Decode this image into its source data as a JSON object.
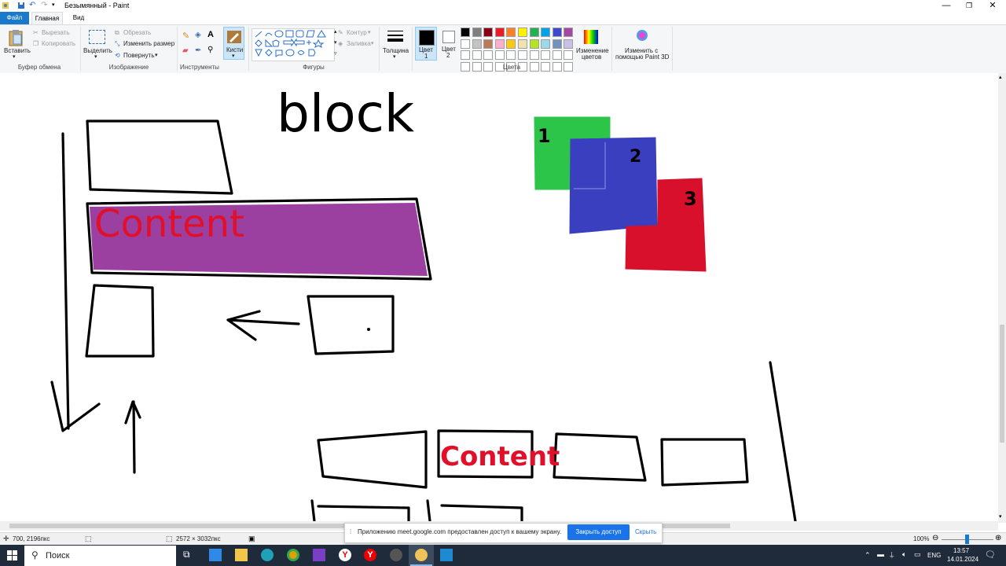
{
  "window": {
    "title": "Безымянный - Paint"
  },
  "tabs": {
    "file": "Файл",
    "home": "Главная",
    "view": "Вид"
  },
  "ribbon": {
    "clipboard": {
      "paste": "Вставить",
      "cut": "Вырезать",
      "copy": "Копировать",
      "group": "Буфер обмена"
    },
    "image": {
      "select": "Выделить",
      "crop": "Обрезать",
      "resize": "Изменить размер",
      "rotate": "Повернуть",
      "group": "Изображение"
    },
    "tools": {
      "brushes": "Кисти",
      "group": "Инструменты"
    },
    "shapes": {
      "outline": "Контур",
      "fill": "Заливка",
      "group": "Фигуры"
    },
    "size": {
      "label": "Толщина"
    },
    "colors": {
      "color1_label": "Цвет",
      "color1_num": "1",
      "color2_label": "Цвет",
      "color2_num": "2",
      "edit_colors_1": "Изменение",
      "edit_colors_2": "цветов",
      "paint3d_1": "Изменить с",
      "paint3d_2": "помощью Paint 3D",
      "group": "Цвета",
      "palette_row1": [
        "#000000",
        "#7f7f7f",
        "#880015",
        "#ed1c24",
        "#ff7f27",
        "#fff200",
        "#22b14c",
        "#00a2e8",
        "#3f48cc",
        "#a349a4"
      ],
      "palette_row2": [
        "#ffffff",
        "#c3c3c3",
        "#b97a57",
        "#ffaec9",
        "#ffc90e",
        "#efe4b0",
        "#b5e61d",
        "#99d9ea",
        "#7092be",
        "#c8bfe7"
      ]
    }
  },
  "canvas": {
    "drawn_text_block": "block",
    "drawn_text_content_1": "Content",
    "drawn_text_content_2": "Content",
    "note_1": "1",
    "note_2": "2",
    "note_3": "3",
    "colors": {
      "purple": "#9b3fa0",
      "green": "#2cc54a",
      "blue": "#3a3fc0",
      "red": "#d9102b",
      "ink_red": "#e0102a"
    }
  },
  "status": {
    "cursor_pos": "700, 2196пкс",
    "image_size": "2572 × 3032пкс",
    "zoom": "100%"
  },
  "share_banner": {
    "message": "Приложению meet.google.com предоставлен доступ к вашему экрану.",
    "stop": "Закрыть доступ",
    "hide": "Скрыть"
  },
  "taskbar": {
    "search": "Поиск",
    "lang": "ENG",
    "time": "13:57",
    "date": "14.01.2024"
  }
}
